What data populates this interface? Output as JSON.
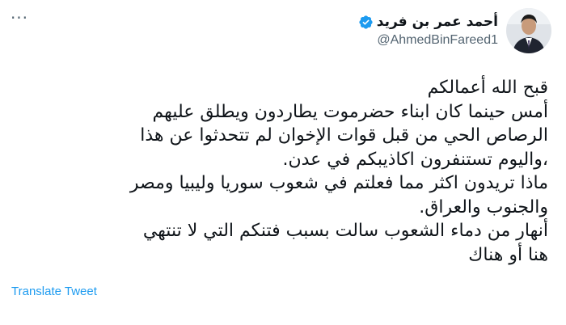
{
  "author": {
    "display_name": "أحمد عمر بن فريد",
    "handle": "@AhmedBinFareed1",
    "verified": true
  },
  "icons": {
    "more": "more-horizontal-icon",
    "verified": "verified-badge-icon"
  },
  "tweet": {
    "lines": [
      "قبح الله أعمالكم",
      "أمس حينما كان ابناء حضرموت يطاردون ويطلق عليهم",
      "الرصاص الحي من قبل قوات الإخوان لم تتحدثوا عن هذا",
      "،واليوم تستنفرون اكاذيبكم في عدن.",
      "ماذا تريدون اكثر مما فعلتم في شعوب سوريا وليبيا ومصر",
      "والجنوب والعراق.",
      "أنهار من دماء الشعوب سالت بسبب فتنكم التي لا تنتهي",
      "هنا أو هناك"
    ]
  },
  "translate_label": "Translate Tweet",
  "colors": {
    "accent": "#1d9bf0",
    "text": "#0f1419",
    "secondary_text": "#536471"
  }
}
